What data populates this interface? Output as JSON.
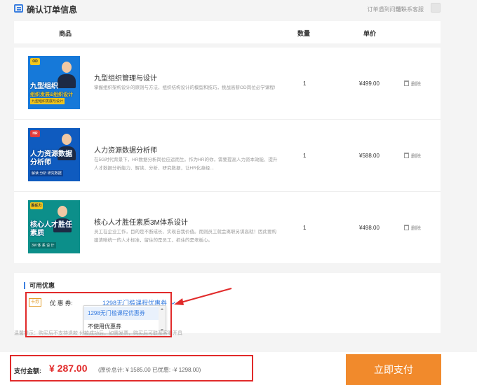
{
  "header": {
    "title": "确认订单信息",
    "help_text": "订单遇到问题?",
    "help_link": "请联系客服"
  },
  "table": {
    "columns": {
      "product": "商品",
      "qty": "数量",
      "price": "单价"
    }
  },
  "items": [
    {
      "name": "九型组织管理与设计",
      "desc": "掌握组织架构设计的原则与方法，组织结构设计的模型和技巧，挑战高薪OD岗位必学课程!",
      "qty": "1",
      "price": "¥499.00",
      "delete_label": "删除",
      "thumb": {
        "badge": "OD",
        "big": "九型组织\n组织发展&组织设计",
        "sub": "九型组织发展与设计",
        "bg": "#1679d9",
        "band": "#f2c61c"
      }
    },
    {
      "name": "人力资源数据分析师",
      "desc": "在5G时代背景下，HR数据分析岗位应运而生。作为HR的你，需要提高人力资本效能、提升人才数据分析能力、解读、分析、研究数据，让HR化身经...",
      "qty": "1",
      "price": "¥588.00",
      "delete_label": "删除",
      "thumb": {
        "badge": "HR",
        "big": "人力资源数据\n分析师",
        "sub": "解读 分析 研究数据",
        "bg": "#0f5bbf",
        "band": "#0b3f8f"
      }
    },
    {
      "name": "核心人才胜任素质3M体系设计",
      "desc": "员工在企业工作，目的是不断成长、实现自我价值。而则员工就会离职另谋高就！因此要构建清晰统一的人才标准，留住的是员工，抓住的是老板心。",
      "qty": "1",
      "price": "¥498.00",
      "delete_label": "删除",
      "thumb": {
        "badge": "胜任力",
        "big": "核心人才胜任\n素质",
        "sub": "3M 体 系 设 计",
        "bg": "#0c8f8a",
        "band": "#0a6f6b"
      }
    }
  ],
  "coupons": {
    "heading": "可用优惠",
    "card_tag": "卡券",
    "label": "优 惠 券:",
    "selected": "1298无门槛课程优惠券",
    "options": [
      "1298无门槛课程优惠券",
      "不使用优惠券"
    ]
  },
  "notice": "温馨提示：购买后不支持退款                                               付款成功后，如需发票，购买后可联系客服开具",
  "payment": {
    "label": "支付金额:",
    "amount": "¥ 287.00",
    "detail": "(原价总计: ¥ 1585.00 已优惠: -¥ 1298.00)",
    "button": "立即支付"
  },
  "colors": {
    "accent": "#3b7fe0",
    "price_red": "#e12a2a",
    "pay_orange": "#f18a2c",
    "annotation_red": "#e12a2a"
  }
}
